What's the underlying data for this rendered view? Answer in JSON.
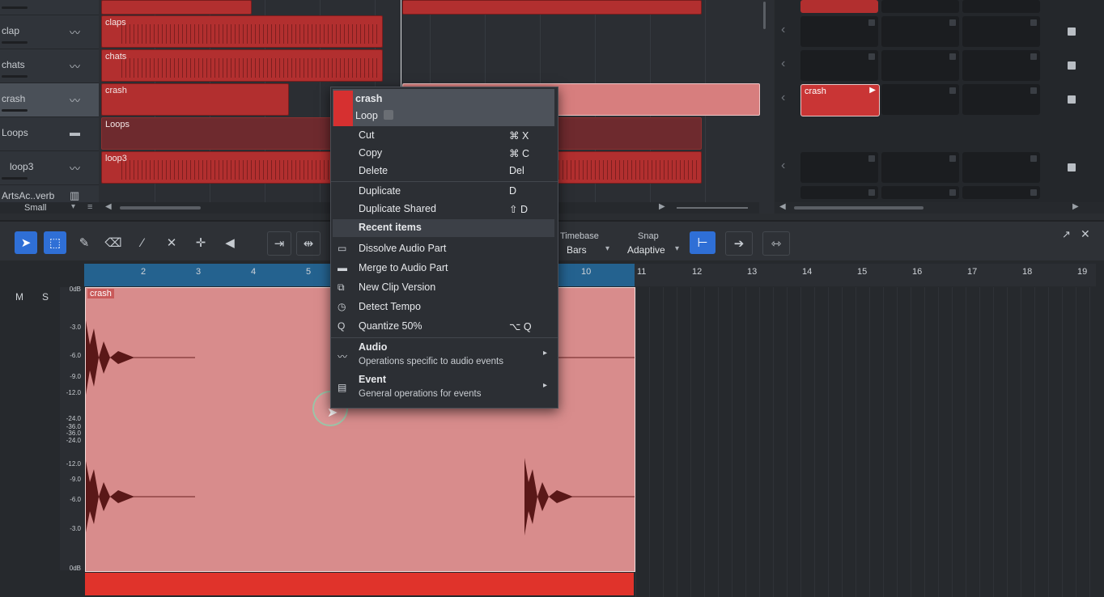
{
  "tracks": [
    {
      "name": "clap"
    },
    {
      "name": "chats"
    },
    {
      "name": "crash"
    },
    {
      "name": "Loops"
    },
    {
      "name": "loop3"
    },
    {
      "name": "ArtsAc..verb"
    }
  ],
  "track_size_label": "Small",
  "clips": {
    "claps": "claps",
    "chats": "chats",
    "crash": "crash",
    "loops": "Loops",
    "loop3": "loop3"
  },
  "scene_clip": "crash",
  "toolbar": {
    "timebase_label": "Timebase",
    "timebase_value": "Bars",
    "snap_label": "Snap",
    "snap_value": "Adaptive"
  },
  "editor": {
    "mute": "M",
    "solo": "S",
    "event_name": "crash",
    "db_labels": [
      "0dB",
      "-3.0",
      "-6.0",
      "-9.0",
      "-12.0",
      "-24.0",
      "-36.0",
      "-36.0",
      "-24.0",
      "-12.0",
      "-9.0",
      "-6.0",
      "-3.0",
      "0dB"
    ],
    "ruler": [
      "2",
      "3",
      "4",
      "5",
      "10",
      "11",
      "12",
      "13",
      "14",
      "15",
      "16",
      "17",
      "18",
      "19"
    ]
  },
  "menu": {
    "header_title": "crash",
    "header_loop": "Loop",
    "cut": "Cut",
    "cut_sc": "⌘ X",
    "copy": "Copy",
    "copy_sc": "⌘ C",
    "delete": "Delete",
    "delete_sc": "Del",
    "duplicate": "Duplicate",
    "duplicate_sc": "D",
    "dup_shared": "Duplicate Shared",
    "dup_shared_sc": "⇧ D",
    "recent": "Recent items",
    "dissolve": "Dissolve Audio Part",
    "merge": "Merge to Audio Part",
    "new_clip": "New Clip Version",
    "detect": "Detect Tempo",
    "quantize": "Quantize 50%",
    "quantize_sc": "⌥ Q",
    "audio": "Audio",
    "audio_sub": "Operations specific to audio events",
    "event": "Event",
    "event_sub": "General operations for events"
  }
}
